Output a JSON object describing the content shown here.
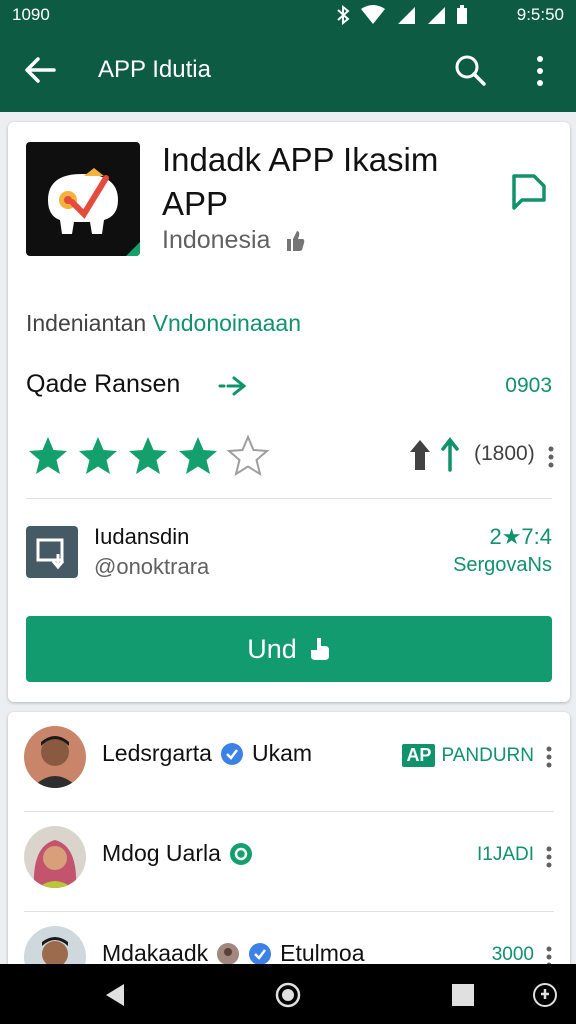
{
  "status_bar": {
    "time_left": "1090",
    "time_right": "9:5:50"
  },
  "app_bar": {
    "title": "APP Idutia"
  },
  "app": {
    "name": "Indadk APP Ikasim APP",
    "country": "Indonesia",
    "subtitle_plain": "Indeniantan ",
    "subtitle_accent": "Vndonoinaaan",
    "section_label": "Qade Ransen",
    "section_code": "0903",
    "rating_stars": 4,
    "rating_max": 5,
    "rating_count": "(1800)",
    "developer_name": "Iudansdin",
    "developer_handle": "@onoktrara",
    "developer_stat": "2★7:4",
    "developer_stat_sub": "SergovaNs",
    "install_label": "Und"
  },
  "people": [
    {
      "name": "Ledsrgarta",
      "extra": "Ukam",
      "tag_box": "AP",
      "tag": "PANDURN"
    },
    {
      "name": "Mdog Uarla",
      "extra": "",
      "tag_box": "",
      "tag": "I1JADI"
    },
    {
      "name": "Mdakaadk",
      "extra": "Etulmoa",
      "tag_box": "",
      "tag": "3000"
    }
  ],
  "colors": {
    "primary": "#0d5b43",
    "accent": "#10926b",
    "button": "#119b6e",
    "star": "#14a06c"
  }
}
